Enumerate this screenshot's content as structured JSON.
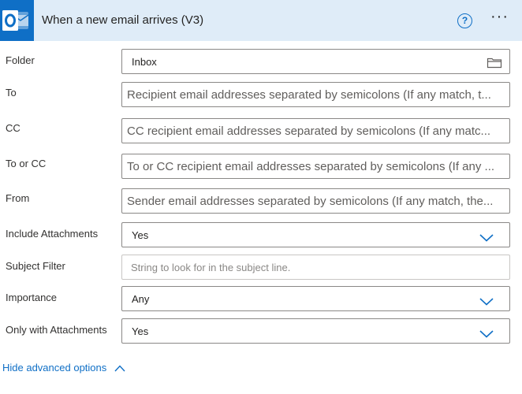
{
  "header": {
    "title": "When a new email arrives (V3)",
    "help_icon": "help-circle-icon",
    "help_glyph": "?",
    "more_label": "···",
    "accent": "#0f6fc6",
    "background": "#dfecf8"
  },
  "fields": {
    "folder": {
      "label": "Folder",
      "value": "Inbox"
    },
    "to": {
      "label": "To",
      "placeholder": "Recipient email addresses separated by semicolons (If any match, t..."
    },
    "cc": {
      "label": "CC",
      "placeholder": "CC recipient email addresses separated by semicolons (If any matc..."
    },
    "to_or_cc": {
      "label": "To or CC",
      "placeholder": "To or CC recipient email addresses separated by semicolons (If any ..."
    },
    "from": {
      "label": "From",
      "placeholder": "Sender email addresses separated by semicolons (If any match, the..."
    },
    "include_attachments": {
      "label": "Include Attachments",
      "value": "Yes"
    },
    "subject_filter": {
      "label": "Subject Filter",
      "placeholder": "String to look for in the subject line."
    },
    "importance": {
      "label": "Importance",
      "value": "Any"
    },
    "only_with_attachments": {
      "label": "Only with Attachments",
      "value": "Yes"
    }
  },
  "footer": {
    "advanced_toggle_label": "Hide advanced options"
  }
}
